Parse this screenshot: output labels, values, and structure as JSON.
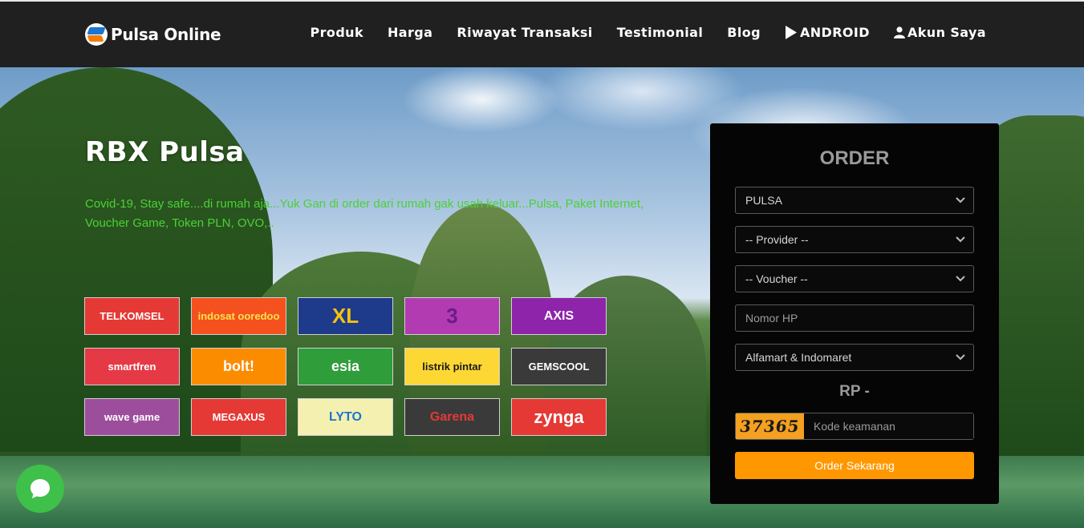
{
  "brand": {
    "name": "Pulsa Online"
  },
  "nav": {
    "items": [
      {
        "label": "Produk"
      },
      {
        "label": "Harga"
      },
      {
        "label": "Riwayat Transaksi"
      },
      {
        "label": "Testimonial"
      },
      {
        "label": "Blog"
      },
      {
        "label": "ANDROID",
        "icon": "play-icon"
      },
      {
        "label": "Akun Saya",
        "icon": "user-icon"
      }
    ]
  },
  "hero": {
    "title": "RBX Pulsa",
    "subtitle": "Covid-19, Stay safe....di rumah aja...Yuk Gan di order dari rumah gak usah keluar...Pulsa, Paket Internet, Voucher Game, Token PLN, OVO,.."
  },
  "providers": [
    {
      "label": "TELKOMSEL",
      "bg": "#e53935",
      "fg": "#ffffff"
    },
    {
      "label": "indosat ooredoo",
      "bg": "#f4511e",
      "fg": "#ffe14d"
    },
    {
      "label": "XL",
      "bg": "#1e3a8a",
      "fg": "#f4c20d"
    },
    {
      "label": "3",
      "bg": "#b23bb2",
      "fg": "#6b1b8a"
    },
    {
      "label": "AXIS",
      "bg": "#8e24aa",
      "fg": "#ffffff"
    },
    {
      "label": "smartfren",
      "bg": "#e53945",
      "fg": "#ffffff"
    },
    {
      "label": "bolt!",
      "bg": "#fb8c00",
      "fg": "#ffffff"
    },
    {
      "label": "esia",
      "bg": "#2e9d3a",
      "fg": "#ffffff"
    },
    {
      "label": "listrik pintar",
      "bg": "#fdd835",
      "fg": "#1a1a1a"
    },
    {
      "label": "GEMSCOOL",
      "bg": "#3a3a3a",
      "fg": "#ffffff"
    },
    {
      "label": "wave game",
      "bg": "#9c4d9c",
      "fg": "#ffffff"
    },
    {
      "label": "MEGAXUS",
      "bg": "#e53935",
      "fg": "#ffffff"
    },
    {
      "label": "LYTO",
      "bg": "#f4f0b0",
      "fg": "#1976d2"
    },
    {
      "label": "Garena",
      "bg": "#3a3a3a",
      "fg": "#e53935"
    },
    {
      "label": "zynga",
      "bg": "#e53935",
      "fg": "#ffffff"
    }
  ],
  "order": {
    "title": "ORDER",
    "product_select": "PULSA",
    "provider_select": "-- Provider --",
    "voucher_select": "-- Voucher --",
    "phone_placeholder": "Nomor HP",
    "payment_select": "Alfamart & Indomaret",
    "price": "RP -",
    "captcha_code": "37365",
    "captcha_placeholder": "Kode keamanan",
    "submit_label": "Order Sekarang"
  },
  "colors": {
    "nav_bg": "#202020",
    "accent": "#ff9800",
    "subtitle": "#4cd137",
    "chat": "#3ec04a"
  }
}
